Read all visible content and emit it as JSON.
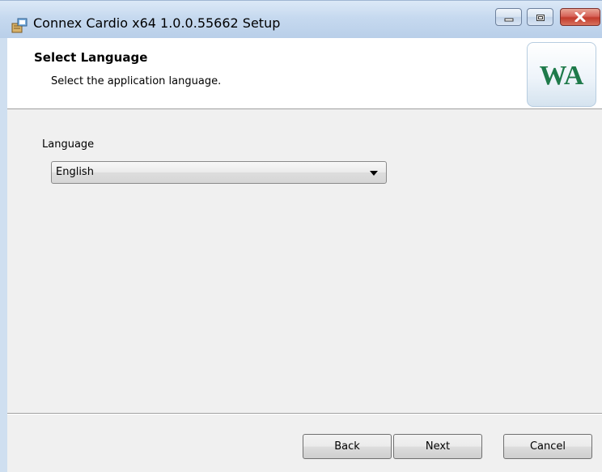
{
  "window": {
    "title": "Connex Cardio x64 1.0.0.55662 Setup"
  },
  "banner": {
    "title": "Select Language",
    "description": "Select the application language.",
    "logo_text": "WA",
    "logo_color": "#1e7a4a"
  },
  "language": {
    "label": "Language",
    "selected": "English"
  },
  "buttons": {
    "back": "Back",
    "next": "Next",
    "cancel": "Cancel"
  },
  "icons": {
    "app": "setup-package-icon",
    "minimize": "minimize-icon",
    "maximize": "maximize-icon",
    "close": "close-icon",
    "dropdown": "chevron-down-icon"
  }
}
